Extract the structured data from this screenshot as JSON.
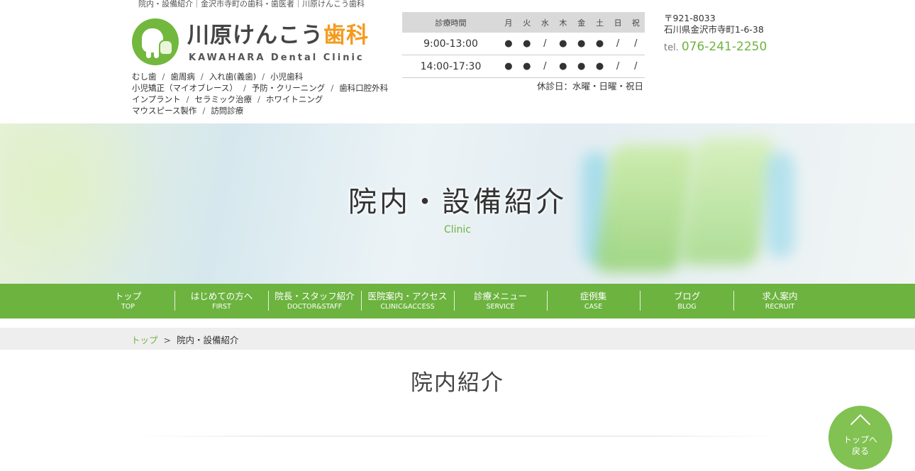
{
  "header": {
    "topline": "院内・設備紹介｜金沢市寺町の歯科・歯医者｜川原けんこう歯科",
    "logo_jp_main": "川原けんこう",
    "logo_jp_accent": "歯科",
    "logo_en": "KAWAHARA Dental Clinic",
    "menu_links": [
      [
        "むし歯",
        "歯周病",
        "入れ歯(義歯)",
        "小児歯科"
      ],
      [
        "小児矯正（マイオブレース）",
        "予防・クリーニング",
        "歯科口腔外科"
      ],
      [
        "インプラント",
        "セラミック治療",
        "ホワイトニング"
      ],
      [
        "マウスピース製作",
        "訪問診療"
      ]
    ],
    "menu_sep": "/",
    "hours": {
      "head_label": "診療時間",
      "days": [
        "月",
        "火",
        "水",
        "木",
        "金",
        "土",
        "日",
        "祝"
      ],
      "rows": [
        {
          "time": "9:00-13:00",
          "marks": [
            "●",
            "●",
            "/",
            "●",
            "●",
            "●",
            "/",
            "/"
          ]
        },
        {
          "time": "14:00-17:30",
          "marks": [
            "●",
            "●",
            "/",
            "●",
            "●",
            "●",
            "/",
            "/"
          ]
        }
      ],
      "holiday": "休診日：水曜・日曜・祝日"
    },
    "address_zip": "〒921-8033",
    "address": "石川県金沢市寺町1-6-38",
    "tel_label": "tel.",
    "tel": "076-241-2250"
  },
  "hero": {
    "title": "院内・設備紹介",
    "subtitle": "Clinic"
  },
  "nav": [
    {
      "jp": "トップ",
      "en": "TOP"
    },
    {
      "jp": "はじめての方へ",
      "en": "FIRST"
    },
    {
      "jp": "院長・スタッフ紹介",
      "en": "DOCTOR&STAFF"
    },
    {
      "jp": "医院案内・アクセス",
      "en": "CLINIC&ACCESS"
    },
    {
      "jp": "診療メニュー",
      "en": "SERVICE"
    },
    {
      "jp": "症例集",
      "en": "CASE"
    },
    {
      "jp": "ブログ",
      "en": "BLOG"
    },
    {
      "jp": "求人案内",
      "en": "RECRUIT"
    }
  ],
  "breadcrumb": {
    "home": "トップ",
    "arrow": ">",
    "current": "院内・設備紹介"
  },
  "main": {
    "section_title": "院内紹介"
  },
  "to_top": {
    "line1": "トップへ",
    "line2": "戻る"
  },
  "colors": {
    "brand_green": "#6cb33f",
    "accent_orange": "#f39b1e"
  }
}
